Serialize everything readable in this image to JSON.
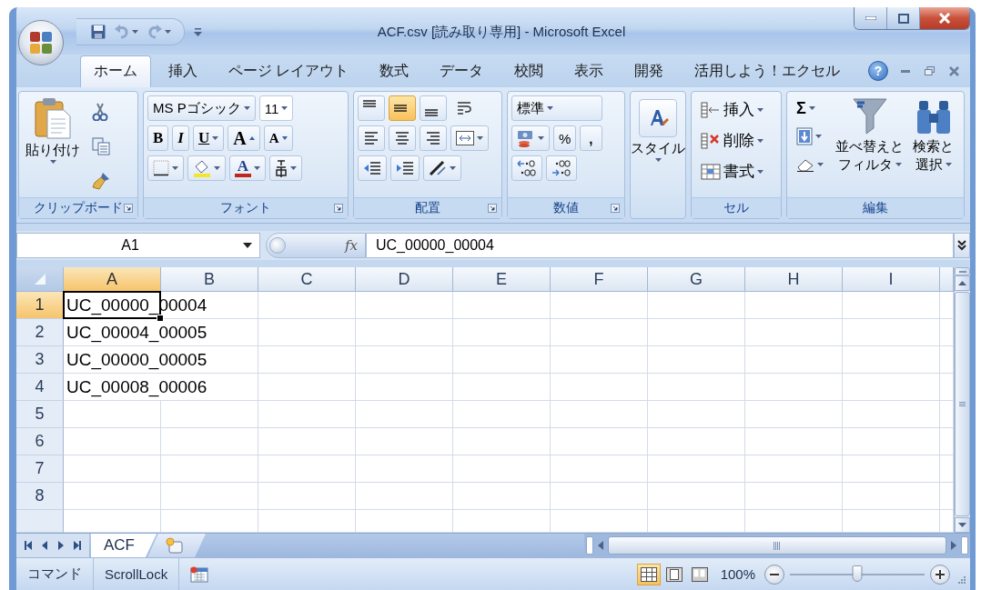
{
  "window": {
    "title": "ACF.csv  [読み取り専用] - Microsoft Excel"
  },
  "tabs": [
    {
      "label": "ホーム",
      "selected": true
    },
    {
      "label": "挿入",
      "selected": false
    },
    {
      "label": "ページ レイアウト",
      "selected": false
    },
    {
      "label": "数式",
      "selected": false
    },
    {
      "label": "データ",
      "selected": false
    },
    {
      "label": "校閲",
      "selected": false
    },
    {
      "label": "表示",
      "selected": false
    },
    {
      "label": "開発",
      "selected": false
    },
    {
      "label": "活用しよう！エクセル",
      "selected": false
    }
  ],
  "help": "?",
  "ribbon": {
    "groups": [
      {
        "kind": "clipboard",
        "label": "クリップボード",
        "paste": "貼り付け"
      },
      {
        "kind": "font",
        "label": "フォント",
        "font_name": "MS Pゴシック",
        "font_size": "11",
        "bold": "B",
        "italic": "I",
        "underline": "U",
        "grow_font": "A",
        "shrink_font": "A",
        "font_color": "A"
      },
      {
        "kind": "alignment",
        "label": "配置",
        "vertical_align": [
          {
            "kind": "top",
            "selected": false
          },
          {
            "kind": "middle",
            "selected": true
          },
          {
            "kind": "bottom",
            "selected": false
          }
        ]
      },
      {
        "kind": "number",
        "label": "数値",
        "format": "標準",
        "percent": "%",
        "comma": ","
      },
      {
        "kind": "styles",
        "button": "スタイル"
      },
      {
        "kind": "cells",
        "label": "セル",
        "items": [
          "挿入",
          "削除",
          "書式"
        ]
      },
      {
        "kind": "editing",
        "label": "編集",
        "autosum": "Σ",
        "sort_filter": [
          "並べ替えと",
          "フィルタ"
        ],
        "find_select": [
          "検索と",
          "選択"
        ]
      }
    ]
  },
  "formula_bar": {
    "name_box": "A1",
    "function_label": "fx",
    "formula": "UC_00000_00004"
  },
  "sheet": {
    "columns": [
      {
        "label": "A",
        "selected": true
      },
      {
        "label": "B",
        "selected": false
      },
      {
        "label": "C",
        "selected": false
      },
      {
        "label": "D",
        "selected": false
      },
      {
        "label": "E",
        "selected": false
      },
      {
        "label": "F",
        "selected": false
      },
      {
        "label": "G",
        "selected": false
      },
      {
        "label": "H",
        "selected": false
      },
      {
        "label": "I",
        "selected": false
      }
    ],
    "rows": [
      {
        "label": "1",
        "selected": true,
        "cells": [
          "UC_00000_00004"
        ]
      },
      {
        "label": "2",
        "selected": false,
        "cells": [
          "UC_00004_00005"
        ]
      },
      {
        "label": "3",
        "selected": false,
        "cells": [
          "UC_00000_00005"
        ]
      },
      {
        "label": "4",
        "selected": false,
        "cells": [
          "UC_00008_00006"
        ]
      },
      {
        "label": "5",
        "selected": false
      },
      {
        "label": "6",
        "selected": false
      },
      {
        "label": "7",
        "selected": false
      },
      {
        "label": "8",
        "selected": false
      }
    ]
  },
  "sheet_tabs": [
    {
      "label": "ACF",
      "selected": true
    }
  ],
  "status_bar": {
    "mode": "コマンド",
    "indicator": "ScrollLock",
    "views": [
      {
        "kind": "normal",
        "selected": true
      },
      {
        "kind": "page_layout",
        "selected": false
      },
      {
        "kind": "page_break",
        "selected": false
      }
    ],
    "zoom": "100%",
    "zoom_slider": {
      "level": 0.5
    }
  }
}
